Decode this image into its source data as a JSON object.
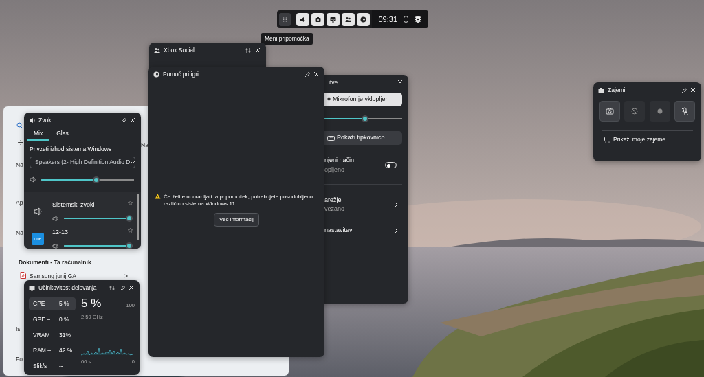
{
  "game_bar": {
    "menu_button": {
      "hovered": true
    },
    "tooltip": "Meni pripomočka",
    "widgets": [
      {
        "kind": "audio",
        "on": true
      },
      {
        "kind": "capture",
        "on": true
      },
      {
        "kind": "performance",
        "on": true
      },
      {
        "kind": "social",
        "on": true
      },
      {
        "kind": "help",
        "on": true
      }
    ],
    "time": "09:31"
  },
  "explorer": {
    "fragments": [
      {
        "text": "Na"
      },
      {
        "text": "Na"
      },
      {
        "text": "Ap"
      },
      {
        "text": "Na"
      },
      {
        "text": "Dokumenti - Ta računalnik",
        "kind": "heading"
      },
      {
        "text": "Samsung junij GA",
        "kind": "file",
        "chevron": ">"
      },
      {
        "text": "Isl"
      },
      {
        "text": "Fo"
      }
    ]
  },
  "xbox_social": {
    "title": "Xbox Social"
  },
  "game_help": {
    "title": "Pomoč pri igri",
    "message": "Če želite uporabljati ta pripomoček, potrebujete posodobljeno različico sistema Windows 11.",
    "button": "Več informacij"
  },
  "settings": {
    "title": "itve",
    "mic_button": "Mikrofon je vklopljen",
    "mic_slider": {
      "level": 0.52
    },
    "keyboard_button": "Pokaži tipkovnico",
    "toggle": {
      "label": "njeni način",
      "sub": "opljeno",
      "on": false
    },
    "links": [
      {
        "label": "arežje",
        "sub": "vezano"
      },
      {
        "label": "nastavitev"
      }
    ]
  },
  "audio": {
    "title": "Zvok",
    "tabs": [
      {
        "label": "Mix",
        "selected": true
      },
      {
        "label": "Glas",
        "selected": false
      }
    ],
    "output_label": "Privzeti izhod sistema Windows",
    "output_device": "Speakers (2- High Definition Audio D",
    "master": {
      "level": 0.6
    },
    "apps": [
      {
        "kind": "system",
        "name": "Sistemski zvoki",
        "level": 1
      },
      {
        "kind": "app",
        "name": "12-13",
        "logo_text": "one",
        "level": 1
      }
    ]
  },
  "performance": {
    "title": "Učinkovitost delovanja",
    "metrics": [
      {
        "label": "CPE –",
        "value": "5 %",
        "selected": true
      },
      {
        "label": "GPE –",
        "value": "0 %",
        "selected": false
      },
      {
        "label": "VRAM",
        "value": "31%",
        "selected": false
      },
      {
        "label": "RAM –",
        "value": "42 %",
        "selected": false
      },
      {
        "label": "Slik/s",
        "value": "--",
        "selected": false
      }
    ],
    "big_value": "5 %",
    "frequency": "2.59 GHz",
    "axis_max": "100",
    "axis_start": "60 s",
    "axis_end": "0"
  },
  "capture": {
    "title": "Zajemi",
    "buttons": [
      {
        "kind": "screenshot",
        "disabled": false
      },
      {
        "kind": "record_last",
        "disabled": true
      },
      {
        "kind": "record",
        "disabled": true
      },
      {
        "kind": "mic",
        "disabled": false,
        "muted": true
      }
    ],
    "link": "Prikaži moje zajeme"
  }
}
